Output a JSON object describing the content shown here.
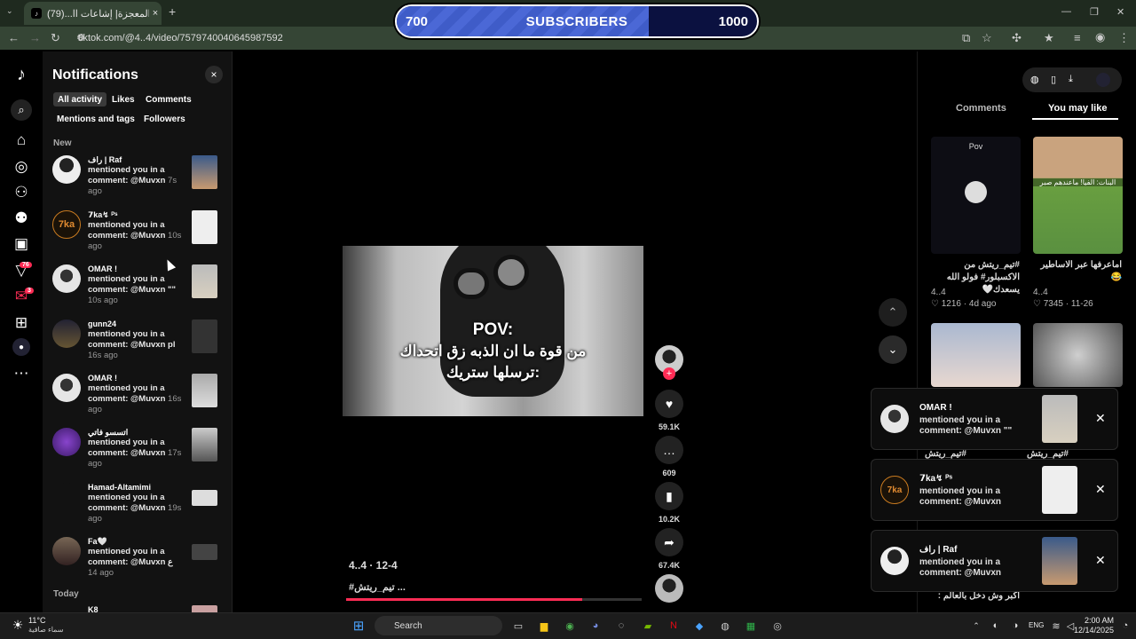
{
  "browser": {
    "tab_title": "طفل المعجزة| إشاعات اا...(79)",
    "tab_close": "×",
    "new_tab": "+",
    "url": "tiktok.com/@4..4/video/7579740040645987592",
    "window_controls": [
      "—",
      "❐",
      "✕"
    ]
  },
  "subscriber_bar": {
    "left": "700",
    "label": "SUBSCRIBERS",
    "right": "1000",
    "progress": 0.7
  },
  "rail": {
    "badges": {
      "inbox": "76",
      "messages": "3"
    }
  },
  "notifications": {
    "title": "Notifications",
    "close": "×",
    "chips": [
      "All activity",
      "Likes",
      "Comments",
      "Mentions and tags",
      "Followers"
    ],
    "section_new": "New",
    "section_today": "Today",
    "items": [
      {
        "name": "راف | Raf",
        "text": "mentioned you in a comment: @Muvxn",
        "ago": "7s ago"
      },
      {
        "name": "𝟳ka↯ ᴾˢ",
        "text": "mentioned you in a comment: @Muvxn",
        "ago": "10s ago"
      },
      {
        "name": "OMAR !",
        "text": "mentioned you in a comment: @Muvxn \"\"",
        "ago": "10s ago"
      },
      {
        "name": "gunn24",
        "text": "mentioned you in a comment: @Muvxn pl",
        "ago": "16s ago"
      },
      {
        "name": "OMAR !",
        "text": "mentioned you in a comment: @Muvxn",
        "ago": "16s ago"
      },
      {
        "name": "اتسسو فاتي",
        "text": "mentioned you in a comment: @Muvxn",
        "ago": "17s ago"
      },
      {
        "name": "Hamad-Altamimi",
        "text": "mentioned you in a comment: @Muvxn",
        "ago": "19s ago"
      },
      {
        "name": "Fa🤍",
        "text": "mentioned you in a comment: @Muvxn ع",
        "ago": "14 ago"
      }
    ],
    "today_first": "K8"
  },
  "video": {
    "caption_line1": "POV:",
    "caption_line2": "من قوة ما ان الذبه زق اتحداك",
    "caption_line3": "ترسلها ستريك:",
    "author_date": "4..4 · 12-4",
    "description": "#تيم_ريتش ...",
    "progress": 0.8,
    "likes": "59.1K",
    "comments": "609",
    "saves": "10.2K",
    "shares": "67.4K"
  },
  "right_panel": {
    "tabs": [
      "Comments",
      "You may like"
    ],
    "cards": [
      {
        "caption": "#تيم_ريتش من الاكسبلور# فولو الله يسعدك🤍",
        "author": "4..4",
        "stats": "♡ 1216 · 4d ago",
        "top_text": "Pov"
      },
      {
        "caption": "اماعرفها عبر الاساطير 😂",
        "author": "4..4",
        "stats": "♡ 7345 · 11-26",
        "top_text": "البنات: الفيا! ماعندهم صبر"
      }
    ],
    "more_captions": [
      "#تيم_ريتش",
      "#تيم_ريتش",
      "اكبر وش دخل بالعالم :"
    ]
  },
  "toasts": [
    {
      "name": "OMAR !",
      "text": "mentioned you in a comment: @Muvxn \"\""
    },
    {
      "name": "𝟳ka↯ ᴾˢ",
      "text": "mentioned you in a comment: @Muvxn"
    },
    {
      "name": "راف | Raf",
      "text": "mentioned you in a comment: @Muvxn"
    }
  ],
  "taskbar": {
    "temp": "11°C",
    "weather": "سماء صافية",
    "search": "Search",
    "lang": "ENG",
    "time": "2:00 AM",
    "date": "12/14/2025"
  },
  "colors": {
    "accent": "#fe2c55",
    "subscriber_fill": "#4b68d6",
    "chrome": "#354535"
  }
}
